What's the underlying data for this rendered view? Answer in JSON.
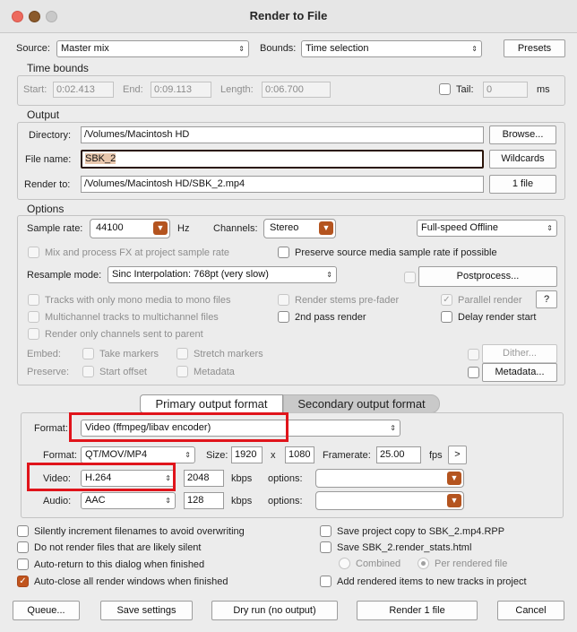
{
  "window": {
    "title": "Render to File",
    "colors": {
      "close": "#ed6a5e",
      "minimize": "#8b5a2b",
      "zoom": "#c9c9c9",
      "accent": "#c0541d",
      "highlight": "#e0141b"
    }
  },
  "top": {
    "source_label": "Source:",
    "source_value": "Master mix",
    "bounds_label": "Bounds:",
    "bounds_value": "Time selection",
    "presets": "Presets"
  },
  "time_bounds": {
    "title": "Time bounds",
    "start_label": "Start:",
    "start": "0:02.413",
    "end_label": "End:",
    "end": "0:09.113",
    "length_label": "Length:",
    "length": "0:06.700",
    "tail_label": "Tail:",
    "tail": "0",
    "tail_unit": "ms"
  },
  "output": {
    "title": "Output",
    "directory_label": "Directory:",
    "directory": "/Volumes/Macintosh HD",
    "browse": "Browse...",
    "filename_label": "File name:",
    "filename": "SBK_2",
    "wildcards": "Wildcards",
    "render_to_label": "Render to:",
    "render_to": "/Volumes/Macintosh HD/SBK_2.mp4",
    "files": "1 file"
  },
  "options": {
    "title": "Options",
    "sample_rate_label": "Sample rate:",
    "sample_rate": "44100",
    "hz": "Hz",
    "channels_label": "Channels:",
    "channels": "Stereo",
    "speed": "Full-speed Offline",
    "mix_fx": "Mix and process FX at project sample rate",
    "preserve_sr": "Preserve source media sample rate if possible",
    "resample_label": "Resample mode:",
    "resample": "Sinc Interpolation: 768pt (very slow)",
    "postprocess": "Postprocess...",
    "mono_tracks": "Tracks with only mono media to mono files",
    "stems_prefader": "Render stems pre-fader",
    "parallel": "Parallel render",
    "help": "?",
    "multichannel": "Multichannel tracks to multichannel files",
    "second_pass": "2nd pass render",
    "delay_start": "Delay render start",
    "only_parent": "Render only channels sent to parent",
    "embed_label": "Embed:",
    "take_markers": "Take markers",
    "stretch_markers": "Stretch markers",
    "dither": "Dither...",
    "preserve_label": "Preserve:",
    "start_offset": "Start offset",
    "metadata_cb": "Metadata",
    "metadata_btn": "Metadata..."
  },
  "format": {
    "tab_primary": "Primary output format",
    "tab_secondary": "Secondary output format",
    "format_label": "Format:",
    "format_value": "Video (ffmpeg/libav encoder)",
    "container_label": "Format:",
    "container": "QT/MOV/MP4",
    "size_label": "Size:",
    "width": "1920",
    "x": "x",
    "height": "1080",
    "framerate_label": "Framerate:",
    "framerate": "25.00",
    "fps": "fps",
    "more": ">",
    "video_label": "Video:",
    "video_codec": "H.264",
    "video_kbps": "2048",
    "kbps1": "kbps",
    "options1": "options:",
    "audio_label": "Audio:",
    "audio_codec": "AAC",
    "audio_kbps": "128",
    "kbps2": "kbps",
    "options2": "options:"
  },
  "bottom": {
    "silent_increment": "Silently increment filenames to avoid overwriting",
    "no_silent": "Do not render files that are likely silent",
    "auto_return": "Auto-return to this dialog when finished",
    "auto_close": "Auto-close all render windows when finished",
    "save_copy": "Save project copy to SBK_2.mp4.RPP",
    "save_stats": "Save SBK_2.render_stats.html",
    "combined": "Combined",
    "per_file": "Per rendered file",
    "add_items": "Add rendered items to new tracks in project",
    "check": "✓"
  },
  "buttons": {
    "queue": "Queue...",
    "save_settings": "Save settings",
    "dry_run": "Dry run (no output)",
    "render": "Render 1 file",
    "cancel": "Cancel"
  }
}
